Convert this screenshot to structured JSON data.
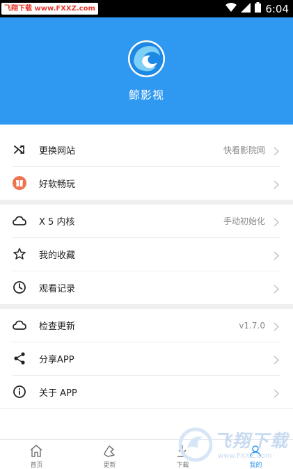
{
  "status_bar": {
    "watermark": "飞翔下载 www.FXXZ.com",
    "time": "6:04"
  },
  "header": {
    "app_name": "鲸影视",
    "bg_color": "#2f98f0"
  },
  "menu": {
    "switch_site": {
      "label": "更换网站",
      "value": "快看影院网",
      "icon": "shuffle-icon"
    },
    "good_software": {
      "label": "好软畅玩",
      "icon": "gift-icon"
    },
    "x5_kernel": {
      "label": "X 5 内核",
      "value": "手动初始化",
      "icon": "cloud-icon"
    },
    "favorites": {
      "label": "我的收藏",
      "icon": "star-icon"
    },
    "history": {
      "label": "观看记录",
      "icon": "clock-icon"
    },
    "check_update": {
      "label": "检查更新",
      "value": "v1.7.0",
      "icon": "cloud-icon"
    },
    "share_app": {
      "label": "分享APP",
      "icon": "share-icon"
    },
    "about_app": {
      "label": "关于 APP",
      "icon": "info-icon"
    }
  },
  "bottom_nav": {
    "items": [
      {
        "label": "首页",
        "icon": "home-icon"
      },
      {
        "label": "更新",
        "icon": "update-icon"
      },
      {
        "label": "下载",
        "icon": "download-icon"
      },
      {
        "label": "我的",
        "icon": "profile-icon",
        "active": true
      }
    ]
  },
  "watermark_corner": {
    "text": "飞翔下载",
    "url": "www.FXXZ.com"
  }
}
